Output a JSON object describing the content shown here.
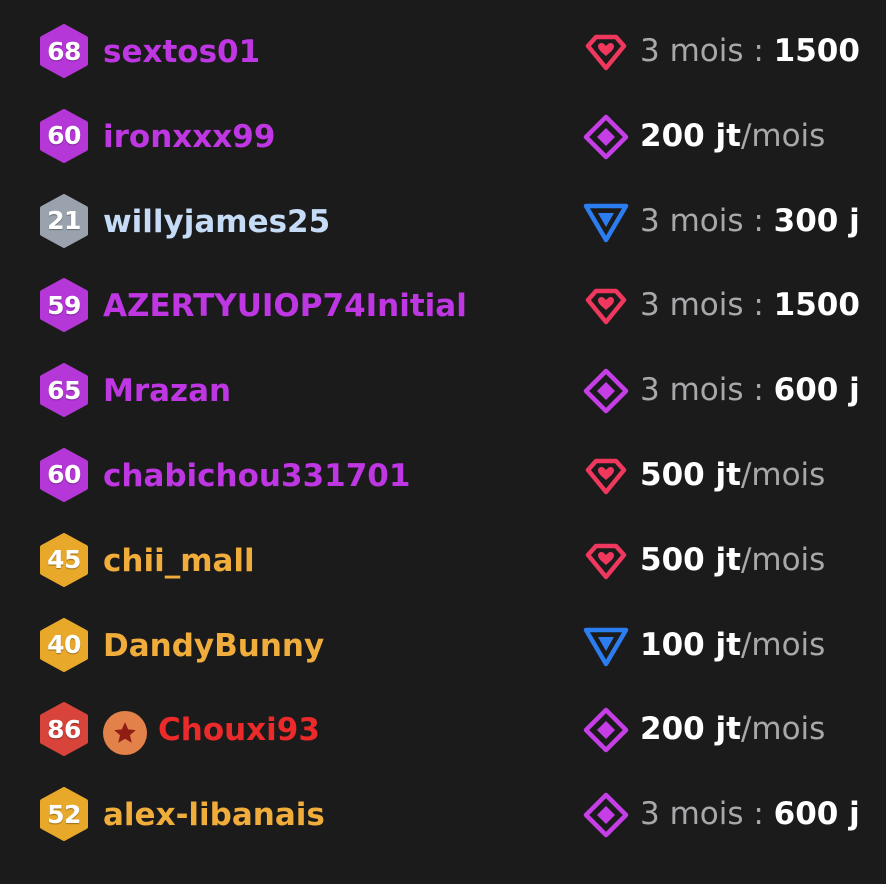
{
  "rows": [
    {
      "level": "68",
      "badge_color": "#b537d8",
      "username": "sextos01",
      "name_color": "#bf36e3",
      "tier": "heart-gem-icon",
      "tier_color": "#f0385f",
      "sub": {
        "prefix": "3 mois : ",
        "amount": "1500",
        "suffix": ""
      }
    },
    {
      "level": "60",
      "badge_color": "#b537d8",
      "username": "ironxxx99",
      "name_color": "#bf36e3",
      "tier": "diamond-icon",
      "tier_color": "#c53ee6",
      "sub": {
        "prefix": "",
        "amount": "200 jt",
        "suffix": "/mois"
      }
    },
    {
      "level": "21",
      "badge_color": "#9aa3ad",
      "username": "willyjames25",
      "name_color": "#c6dcf6",
      "tier": "triangle-down-icon",
      "tier_color": "#2b7df0",
      "sub": {
        "prefix": "3 mois : ",
        "amount": "300 j",
        "suffix": ""
      }
    },
    {
      "level": "59",
      "badge_color": "#b537d8",
      "username": "AZERTYUIOP74Initial",
      "name_color": "#bf36e3",
      "tier": "heart-gem-icon",
      "tier_color": "#f0385f",
      "sub": {
        "prefix": "3 mois : ",
        "amount": "1500",
        "suffix": ""
      }
    },
    {
      "level": "65",
      "badge_color": "#b537d8",
      "username": "Mrazan",
      "name_color": "#bf36e3",
      "tier": "diamond-icon",
      "tier_color": "#c53ee6",
      "sub": {
        "prefix": "3 mois : ",
        "amount": "600 j",
        "suffix": ""
      }
    },
    {
      "level": "60",
      "badge_color": "#b537d8",
      "username": "chabichou331701",
      "name_color": "#bf36e3",
      "tier": "heart-gem-icon",
      "tier_color": "#f0385f",
      "sub": {
        "prefix": "",
        "amount": "500 jt",
        "suffix": "/mois"
      }
    },
    {
      "level": "45",
      "badge_color": "#e8a92a",
      "username": "chii_mall",
      "name_color": "#f1ad3b",
      "tier": "heart-gem-icon",
      "tier_color": "#f0385f",
      "sub": {
        "prefix": "",
        "amount": "500 jt",
        "suffix": "/mois"
      }
    },
    {
      "level": "40",
      "badge_color": "#e8a92a",
      "username": "DandyBunny",
      "name_color": "#f1ad3b",
      "tier": "triangle-down-icon",
      "tier_color": "#2b7df0",
      "sub": {
        "prefix": "",
        "amount": "100 jt",
        "suffix": "/mois"
      }
    },
    {
      "level": "86",
      "badge_color": "#d8433a",
      "username": "Chouxi93",
      "name_color": "#ec2a2a",
      "star": true,
      "tier": "diamond-icon",
      "tier_color": "#c53ee6",
      "sub": {
        "prefix": "",
        "amount": "200 jt",
        "suffix": "/mois"
      }
    },
    {
      "level": "52",
      "badge_color": "#e8a92a",
      "username": "alex-libanais",
      "name_color": "#f1ad3b",
      "tier": "diamond-icon",
      "tier_color": "#c53ee6",
      "sub": {
        "prefix": "3 mois : ",
        "amount": "600 j",
        "suffix": ""
      }
    }
  ]
}
